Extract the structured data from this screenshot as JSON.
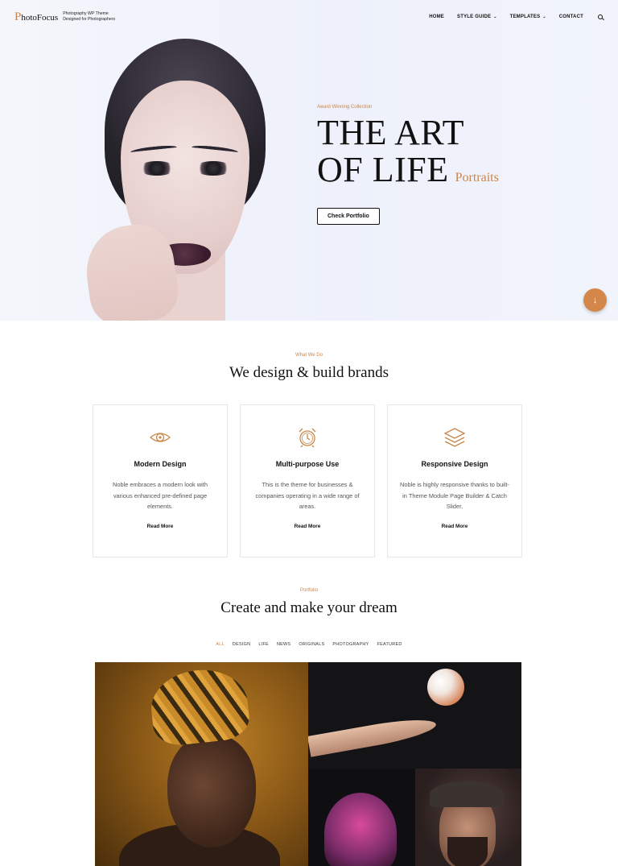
{
  "brand": {
    "name_first_letter": "P",
    "name_rest": "hotoFocus",
    "tagline_line1": "Photography WP Theme",
    "tagline_line2": "Designed for Photographers"
  },
  "nav": {
    "items": [
      {
        "label": "HOME",
        "dropdown": false
      },
      {
        "label": "STYLE GUIDE",
        "dropdown": true
      },
      {
        "label": "TEMPLATES",
        "dropdown": true
      },
      {
        "label": "CONTACT",
        "dropdown": false
      }
    ],
    "search_icon": "search-icon",
    "caret_glyph": "⌄"
  },
  "hero": {
    "eyebrow": "Award Winning Collection",
    "title_line1": "THE ART",
    "title_line2": "OF LIFE",
    "subtitle": "Portraits",
    "button_label": "Check Portfolio",
    "scroll_arrow": "↓"
  },
  "services": {
    "eyebrow": "What We Do",
    "title": "We design & build brands",
    "cards": [
      {
        "icon": "eye-icon",
        "title": "Modern Design",
        "text": "Noble embraces a modern look with various enhanced pre-defined page elements.",
        "link": "Read More"
      },
      {
        "icon": "alarm-clock-icon",
        "title": "Multi-purpose Use",
        "text": "This is the theme for businesses & companies operating in a wide range of areas.",
        "link": "Read More"
      },
      {
        "icon": "layers-icon",
        "title": "Responsive Design",
        "text": "Noble is highly responsive thanks to built-in Theme Module Page Builder & Catch Slider.",
        "link": "Read More"
      }
    ]
  },
  "portfolio": {
    "eyebrow": "Portfolio",
    "title": "Create and make your dream",
    "filters": [
      "ALL",
      "DESIGN",
      "LIFE",
      "NEWS",
      "ORIGINALS",
      "PHOTOGRAPHY",
      "FEATURED"
    ],
    "active_filter": "ALL"
  },
  "colors": {
    "accent": "#c8864a",
    "scroll_button": "#d4874a",
    "text": "#111111"
  }
}
